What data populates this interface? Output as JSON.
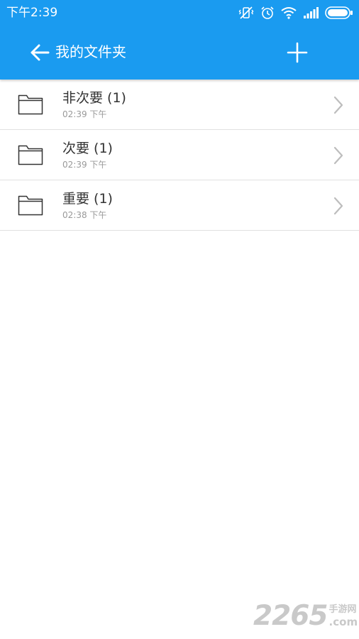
{
  "status_bar": {
    "time": "下午2:39",
    "icons": [
      "vibrate-off-icon",
      "alarm-icon",
      "wifi-icon",
      "signal-icon",
      "battery-icon"
    ]
  },
  "app_bar": {
    "title": "我的文件夹",
    "back_icon": "arrow-left-icon",
    "add_icon": "plus-icon",
    "background_color": "#1a9bf0"
  },
  "folders": [
    {
      "name": "非次要 (1)",
      "time": "02:39 下午"
    },
    {
      "name": "次要 (1)",
      "time": "02:39 下午"
    },
    {
      "name": "重要 (1)",
      "time": "02:38 下午"
    }
  ],
  "watermark": {
    "digits": "2265",
    "top_text": "手游网",
    "bottom_text": ".com"
  }
}
